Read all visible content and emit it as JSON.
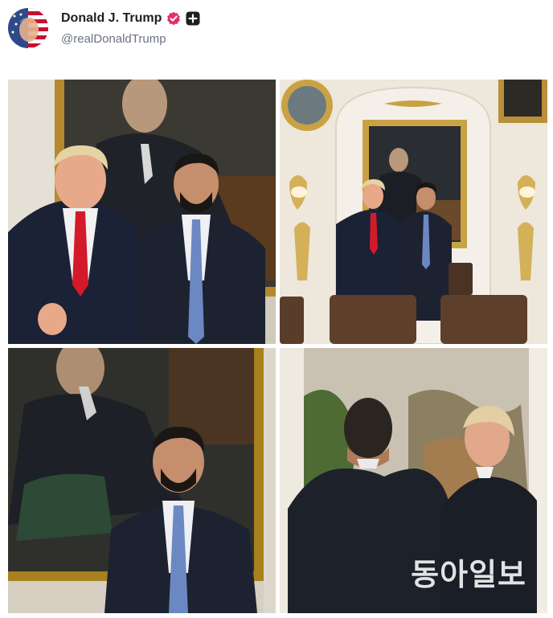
{
  "post": {
    "author": {
      "display_name": "Donald J. Trump",
      "handle": "@realDonaldTrump",
      "avatar_icon": "flag-portrait-avatar",
      "verified_icon": "verified-badge-icon",
      "plus_icon": "plus-badge-icon",
      "verified_color": "#e1306c"
    },
    "media": {
      "count": 4,
      "watermark": "동아일보"
    }
  }
}
